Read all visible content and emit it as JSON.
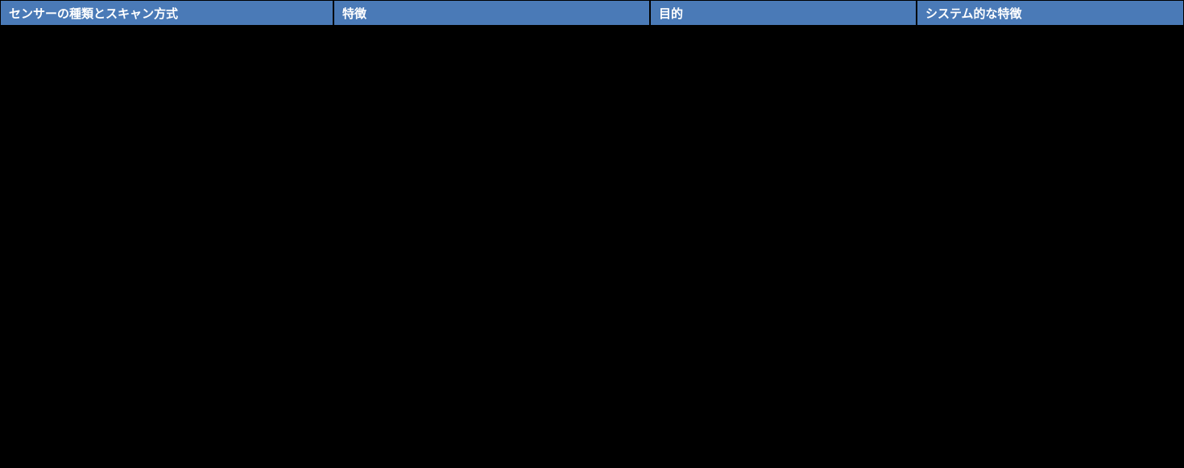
{
  "table": {
    "headers": {
      "col1": "センサーの種類とスキャン方式",
      "col2": "特徴",
      "col3": "目的",
      "col4": "システム的な特徴"
    }
  }
}
